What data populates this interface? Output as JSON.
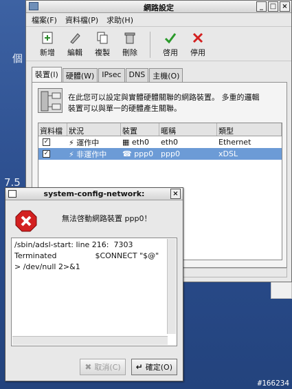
{
  "desktop": {
    "left_char": "個",
    "version_text": "7.5",
    "watermark": "#166234"
  },
  "main_window": {
    "title": "網路設定",
    "controls": [
      "_",
      "□",
      "×"
    ],
    "menu": [
      "檔案(F)",
      "資料檔(P)",
      "求助(H)"
    ],
    "toolbar": [
      {
        "label": "新增",
        "icon": "add-icon"
      },
      {
        "label": "編輯",
        "icon": "edit-icon"
      },
      {
        "label": "複製",
        "icon": "copy-icon"
      },
      {
        "label": "刪除",
        "icon": "delete-icon"
      },
      {
        "label": "啓用",
        "icon": "checkmark-icon"
      },
      {
        "label": "停用",
        "icon": "cross-icon"
      }
    ],
    "tabs": [
      "裝置(I)",
      "硬體(W)",
      "IPsec",
      "DNS",
      "主機(O)"
    ],
    "info_text_line1": "在此您可以設定與實體硬體關聯的網路裝置。 多重的邏輯",
    "info_text_line2": "裝置可以與單一的硬體產生關聯。",
    "columns": [
      "資料檔",
      "狀況",
      "裝置",
      "暱稱",
      "類型"
    ],
    "rows": [
      {
        "checked": "✓",
        "status": "運作中",
        "device": "eth0",
        "nickname": "eth0",
        "type": "Ethernet"
      },
      {
        "checked": "✓",
        "status": "非運作中",
        "device": "ppp0",
        "nickname": "ppp0",
        "type": "xDSL"
      }
    ]
  },
  "dialog": {
    "title": "system-config-network:",
    "close": "×",
    "message": "無法啓動網路裝置 ppp0！",
    "details": [
      "/sbin/adsl-start: line 216:  7303",
      "Terminated                $CONNECT \"$@\"",
      "> /dev/null 2>&1"
    ],
    "cancel_label": "取消(C)",
    "ok_label": "確定(O)"
  },
  "colors": {
    "selection": "#6c9bd6",
    "error_red": "#d32020",
    "desktop": "#2d4f8a"
  }
}
